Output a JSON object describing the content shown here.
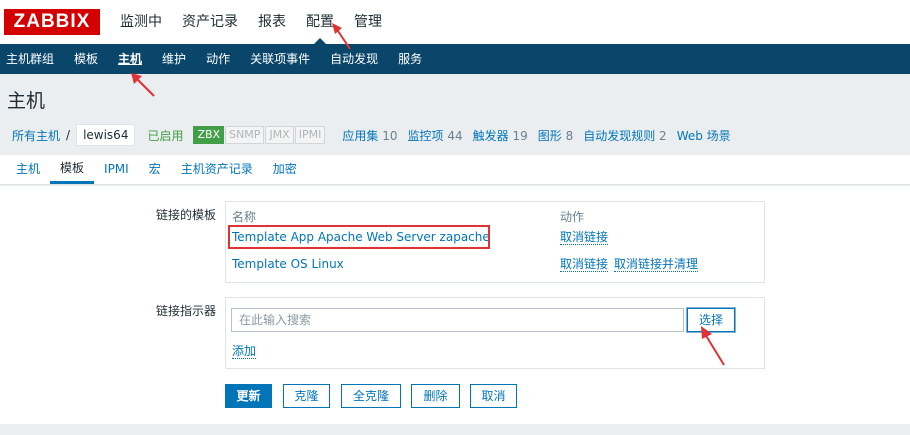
{
  "logo": "ZABBIX",
  "topmenu": [
    "监测中",
    "资产记录",
    "报表",
    "配置",
    "管理"
  ],
  "submenu": [
    "主机群组",
    "模板",
    "主机",
    "维护",
    "动作",
    "关联项事件",
    "自动发现",
    "服务"
  ],
  "page_title": "主机",
  "hostnav": {
    "all_hosts": "所有主机",
    "separator": "/",
    "host": "lewis64",
    "status": "已启用",
    "badges": [
      "ZBX",
      "SNMP",
      "JMX",
      "IPMI"
    ],
    "links": [
      {
        "label": "应用集",
        "count": "10"
      },
      {
        "label": "监控项",
        "count": "44"
      },
      {
        "label": "触发器",
        "count": "19"
      },
      {
        "label": "图形",
        "count": "8"
      },
      {
        "label": "自动发现规则",
        "count": "2"
      },
      {
        "label": "Web 场景",
        "count": ""
      }
    ]
  },
  "tabs": [
    "主机",
    "模板",
    "IPMI",
    "宏",
    "主机资产记录",
    "加密"
  ],
  "linked_templates": {
    "label": "链接的模板",
    "col_name": "名称",
    "col_action": "动作",
    "rows": [
      {
        "name": "Template App Apache Web Server zapache",
        "actions": [
          "取消链接"
        ]
      },
      {
        "name": "Template OS Linux",
        "actions": [
          "取消链接",
          "取消链接并清理"
        ]
      }
    ]
  },
  "link_indicator": {
    "label": "链接指示器",
    "placeholder": "在此输入搜索",
    "select_button": "选择",
    "add_link": "添加"
  },
  "buttons": {
    "update": "更新",
    "clone": "克隆",
    "full_clone": "全克隆",
    "delete": "删除",
    "cancel": "取消"
  },
  "colors": {
    "brand": "#d40000",
    "nav_bg": "#0a466a",
    "link": "#0275b8",
    "enabled": "#429e47",
    "annotation": "#e03234"
  }
}
